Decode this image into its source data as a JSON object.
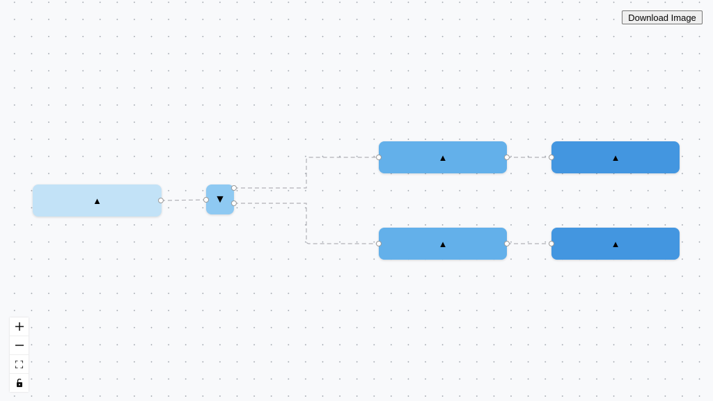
{
  "toolbar": {
    "download_label": "Download Image"
  },
  "nodes": [
    {
      "id": "n1",
      "icon": "▲",
      "color": "#c2e2f7"
    },
    {
      "id": "n2",
      "icon": "▼",
      "color": "#8ec9f2"
    },
    {
      "id": "n3",
      "icon": "▲",
      "color": "#63b0ea"
    },
    {
      "id": "n4",
      "icon": "▲",
      "color": "#4396e0"
    },
    {
      "id": "n5",
      "icon": "▲",
      "color": "#63b0ea"
    },
    {
      "id": "n6",
      "icon": "▲",
      "color": "#4396e0"
    }
  ],
  "edges": [
    {
      "from": "n1",
      "to": "n2"
    },
    {
      "from": "n2",
      "to": "n3"
    },
    {
      "from": "n2",
      "to": "n5"
    },
    {
      "from": "n3",
      "to": "n4"
    },
    {
      "from": "n5",
      "to": "n6"
    }
  ],
  "controls": [
    {
      "name": "zoom-in",
      "icon": "+"
    },
    {
      "name": "zoom-out",
      "icon": "—"
    },
    {
      "name": "fit-view",
      "icon": "⛶"
    },
    {
      "name": "lock",
      "icon": "🔓"
    }
  ]
}
